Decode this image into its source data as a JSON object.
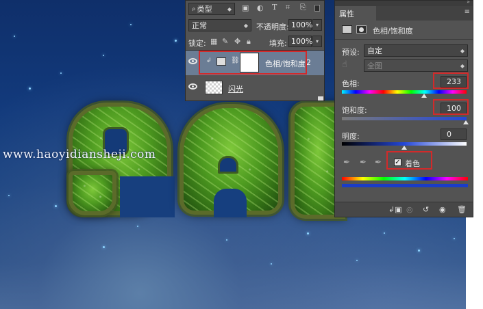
{
  "watermark": "www.haoyidiansheji.com",
  "layers_panel": {
    "filter_kind": "类型",
    "blend_mode": "正常",
    "opacity_label": "不透明度:",
    "opacity_value": "100%",
    "lock_label": "锁定:",
    "fill_label": "填充:",
    "fill_value": "100%",
    "layers": [
      {
        "name": "色相/饱和度",
        "extra": "2",
        "selected": true
      },
      {
        "name": "闪光",
        "selected": false
      }
    ],
    "filter_icons": [
      "image-icon",
      "circle-icon",
      "text-icon",
      "transform-icon",
      "smart-object-icon"
    ]
  },
  "properties_panel": {
    "tab_label": "属性",
    "title": "色相/饱和度",
    "preset_label": "预设:",
    "preset_value": "自定",
    "channel_value": "全图",
    "hue_label": "色相:",
    "hue_value": "233",
    "saturation_label": "饱和度:",
    "saturation_value": "100",
    "lightness_label": "明度:",
    "lightness_value": "0",
    "colorize_label": "着色",
    "colorize_checked": true,
    "hue_position": 0.82,
    "saturation_position": 1.0,
    "lightness_position": 0.5,
    "bottom_icons": [
      "clip-to-layer-icon",
      "view-previous-icon",
      "reset-icon",
      "visibility-icon",
      "delete-icon"
    ]
  },
  "colors": {
    "highlight": "#d22a2a",
    "panel_bg": "#535353",
    "selected_layer": "#6b7d95",
    "colorize_tint": "#1a3cc8"
  }
}
